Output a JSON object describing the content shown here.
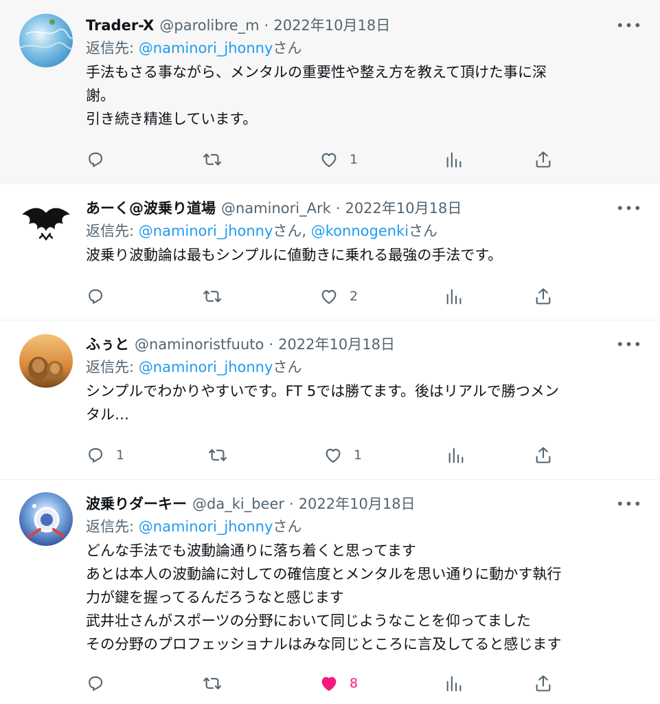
{
  "tweets": [
    {
      "name": "Trader-X",
      "handle": "@parolibre_m",
      "dot": "·",
      "date": "2022年10月18日",
      "reply_prefix": "返信先: ",
      "mentions": [
        "@naminori_jhonny"
      ],
      "san": "さん",
      "text": "手法もさる事ながら、メンタルの重要性や整え方を教えて頂けた事に深\n謝。\n引き続き精進しています。",
      "reply_count": "",
      "retweet_count": "",
      "like_count": "1",
      "liked": false,
      "highlighted": true
    },
    {
      "name": "あーく@波乗り道場",
      "handle": "@naminori_Ark",
      "dot": "·",
      "date": "2022年10月18日",
      "reply_prefix": "返信先: ",
      "mentions": [
        "@naminori_jhonny",
        "@konnogenki"
      ],
      "san": "さん",
      "separator": ", ",
      "text": "波乗り波動論は最もシンプルに値動きに乗れる最強の手法です。",
      "reply_count": "",
      "retweet_count": "",
      "like_count": "2",
      "liked": false,
      "highlighted": false
    },
    {
      "name": "ふぅと",
      "handle": "@naminoristfuuto",
      "dot": "·",
      "date": "2022年10月18日",
      "reply_prefix": "返信先: ",
      "mentions": [
        "@naminori_jhonny"
      ],
      "san": "さん",
      "text": "シンプルでわかりやすいです。FT 5では勝てます。後はリアルで勝つメン\nタル…",
      "reply_count": "1",
      "retweet_count": "",
      "like_count": "1",
      "liked": false,
      "highlighted": false
    },
    {
      "name": "波乗りダーキー",
      "handle": "@da_ki_beer",
      "dot": "·",
      "date": "2022年10月18日",
      "reply_prefix": "返信先: ",
      "mentions": [
        "@naminori_jhonny"
      ],
      "san": "さん",
      "text": "どんな手法でも波動論通りに落ち着くと思ってます\nあとは本人の波動論に対しての確信度とメンタルを思い通りに動かす執行\n力が鍵を握ってるんだろうなと感じます\n武井壮さんがスポーツの分野において同じようなことを仰ってました\nその分野のプロフェッショナルはみな同じところに言及してると感じます",
      "reply_count": "",
      "retweet_count": "",
      "like_count": "8",
      "liked": true,
      "highlighted": false
    }
  ],
  "more_label": "•••",
  "colors": {
    "link": "#1d9bf0",
    "secondary_text": "#536471",
    "like_active": "#f91880",
    "highlight_bg": "#f7f7f7"
  },
  "icons": {
    "reply": "reply-icon",
    "retweet": "retweet-icon",
    "like": "like-icon",
    "analytics": "analytics-icon",
    "share": "share-icon",
    "more": "more-icon"
  }
}
